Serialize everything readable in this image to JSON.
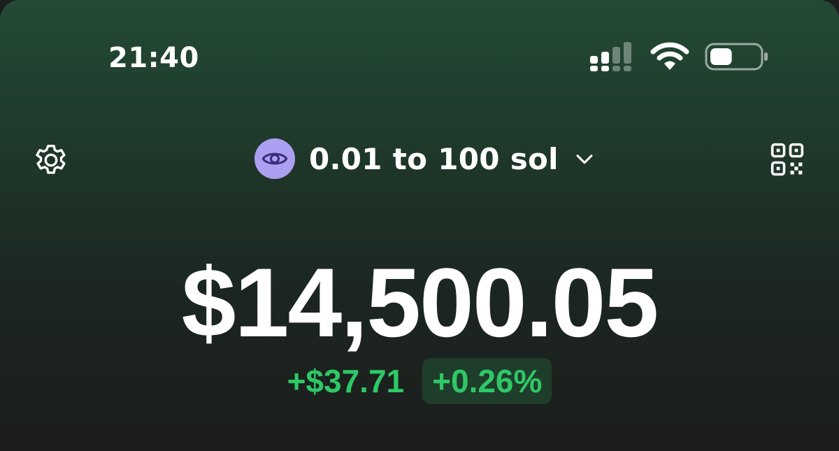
{
  "status_bar": {
    "time": "21:40",
    "signal_icon": "cellular-signal-icon",
    "wifi_icon": "wifi-icon",
    "battery_icon": "battery-icon",
    "battery_level": 0.45
  },
  "header": {
    "settings_icon": "gear-icon",
    "account_avatar_icon": "eye-icon",
    "account_avatar_color": "#ab9ff2",
    "account_name": "0.01 to 100 sol",
    "dropdown_icon": "chevron-down-icon",
    "qr_icon": "qr-code-icon"
  },
  "portfolio": {
    "balance": "$14,500.05",
    "change_amount": "+$37.71",
    "change_percent": "+0.26%",
    "positive_color": "#2ec866"
  }
}
